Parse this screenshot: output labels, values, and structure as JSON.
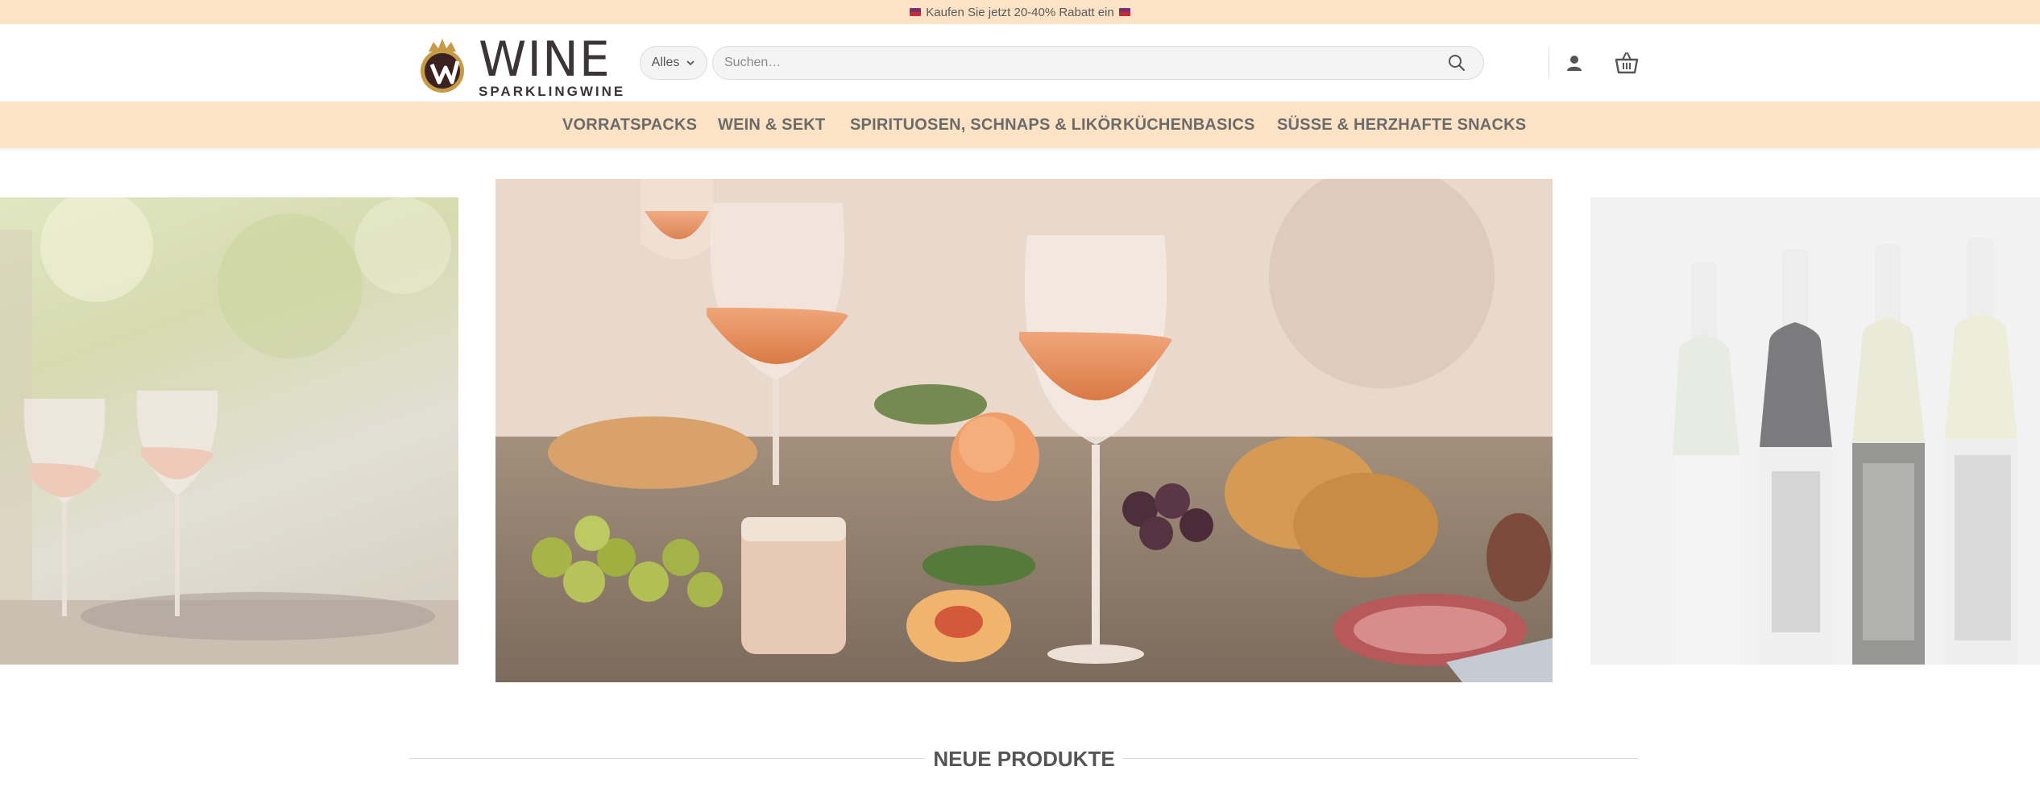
{
  "promo": {
    "text": "Kaufen Sie jetzt 20-40% Rabatt ein"
  },
  "logo": {
    "word": "WINE",
    "sub": "SPARKLINGWINE"
  },
  "search": {
    "category": "Alles",
    "placeholder": "Suchen…"
  },
  "icons": {
    "category_chevron": "chevron-down-icon",
    "search": "search-icon",
    "account": "user-icon",
    "cart": "basket-icon"
  },
  "nav": {
    "items": [
      {
        "label": "VORRATSPACKS"
      },
      {
        "label": "WEIN & SEKT"
      },
      {
        "label": "SPIRITUOSEN, SCHNAPS & LIKÖR"
      },
      {
        "label": "KÜCHENBASICS"
      },
      {
        "label": "SÜSSE & HERZHAFTE SNACKS"
      }
    ]
  },
  "slider": {
    "slides": [
      {
        "name": "rose-glasses-vineyard"
      },
      {
        "name": "rose-wine-picnic-table"
      },
      {
        "name": "young-poets-wine-bottles"
      }
    ]
  },
  "section": {
    "title": "NEUE PRODUKTE"
  },
  "colors": {
    "accent_bar": "#fde3c6",
    "logo_gold": "#c79a45",
    "logo_dark": "#3b3535",
    "text": "#6b6b6b"
  }
}
